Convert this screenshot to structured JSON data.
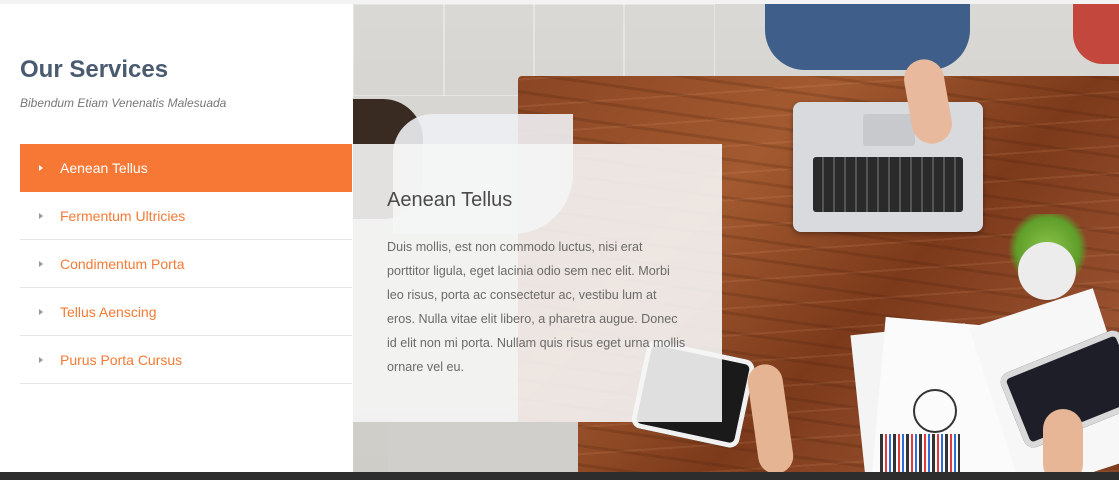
{
  "section": {
    "title": "Our Services",
    "subtitle": "Bibendum Etiam Venenatis Malesuada"
  },
  "menu": {
    "active_index": 0,
    "items": [
      {
        "label": "Aenean Tellus",
        "active": true
      },
      {
        "label": "Fermentum Ultricies",
        "active": false
      },
      {
        "label": "Condimentum Porta",
        "active": false
      },
      {
        "label": "Tellus Aenscing",
        "active": false
      },
      {
        "label": "Purus Porta Cursus",
        "active": false
      }
    ]
  },
  "content": {
    "title": "Aenean Tellus",
    "body": "Duis mollis, est non commodo luctus, nisi erat porttitor ligula, eget lacinia odio sem nec elit. Morbi leo risus, porta ac consectetur ac, vestibu lum at eros. Nulla vitae elit libero, a pharetra augue. Donec id elit non mi porta. Nullam quis risus eget urna mollis ornare vel eu."
  },
  "colors": {
    "accent": "#f77734",
    "accent_text": "#f47a35",
    "heading": "#4a5a70",
    "footer_bar": "#2d2d2d"
  },
  "icons": {
    "menu_item_marker": "caret-right-icon"
  }
}
